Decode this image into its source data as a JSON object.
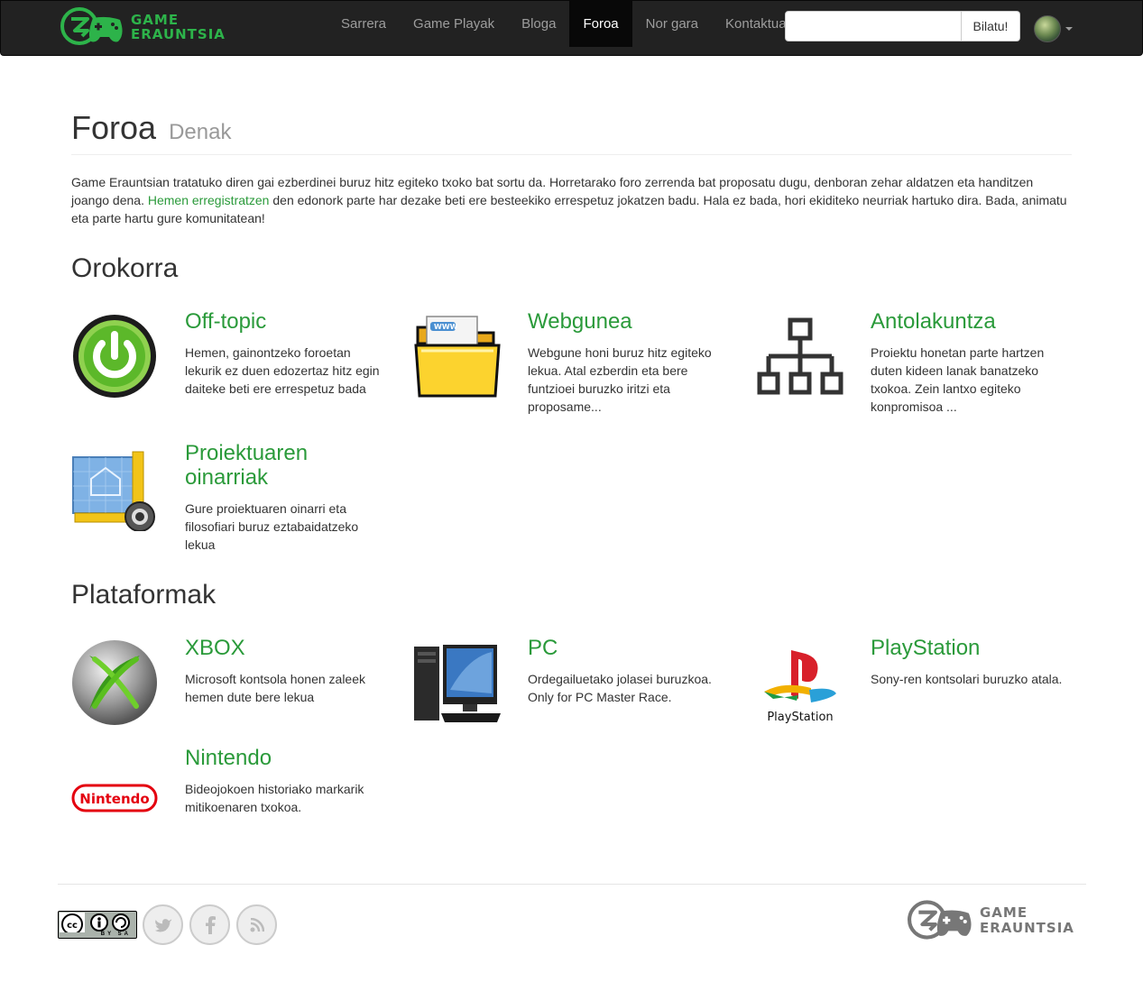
{
  "brand": {
    "line1": "GAME",
    "line2": "ERAUNTSIA"
  },
  "nav": [
    {
      "label": "Sarrera"
    },
    {
      "label": "Game Playak"
    },
    {
      "label": "Bloga"
    },
    {
      "label": "Foroa",
      "active": true
    },
    {
      "label": "Nor gara"
    },
    {
      "label": "Kontaktua"
    }
  ],
  "search": {
    "value": "",
    "placeholder": "",
    "button": "Bilatu!"
  },
  "page": {
    "title": "Foroa",
    "subtitle": "Denak",
    "intro_before": "Game Erauntsian tratatuko diren gai ezberdinei buruz hitz egiteko txoko bat sortu da. Horretarako foro zerrenda bat proposatu dugu, denboran zehar aldatzen eta handitzen joango dena. ",
    "intro_link": "Hemen erregistratzen",
    "intro_after": " den edonork parte har dezake beti ere besteekiko errespetuz jokatzen badu. Hala ez bada, hori ekiditeko neurriak hartuko dira. Bada, animatu eta parte hartu gure komunitatean!"
  },
  "sections": [
    {
      "title": "Orokorra",
      "forums": [
        {
          "title": "Off-topic",
          "desc": "Hemen, gainontzeko foroetan lekurik ez duen edozertaz hitz egin daiteke beti ere errespetuz bada",
          "icon": "power-icon"
        },
        {
          "title": "Webgunea",
          "desc": "Webgune honi buruz hitz egiteko lekua. Atal ezberdin eta bere funtzioei buruzko iritzi eta proposame...",
          "icon": "folder-www-icon"
        },
        {
          "title": "Antolakuntza",
          "desc": "Proiektu honetan parte hartzen duten kideen lanak banatzeko txokoa. Zein lantxo egiteko konpromisoa ...",
          "icon": "org-chart-icon"
        },
        {
          "title": "Proiektuaren oinarriak",
          "desc": "Gure proiektuaren oinarri eta filosofiari buruz eztabaidatzeko lekua",
          "icon": "blueprint-icon"
        }
      ]
    },
    {
      "title": "Plataformak",
      "forums": [
        {
          "title": "XBOX",
          "desc": "Microsoft kontsola honen zaleek hemen dute bere lekua",
          "icon": "xbox-icon"
        },
        {
          "title": "PC",
          "desc": "Ordegailuetako jolasei buruzkoa. Only for PC Master Race.",
          "icon": "pc-icon"
        },
        {
          "title": "PlayStation",
          "desc": "Sony-ren kontsolari buruzko atala.",
          "icon": "playstation-icon",
          "logo_text": "PlayStation"
        },
        {
          "title": "Nintendo",
          "desc": "Bideojokoen historiako markarik mitikoenaren txokoa.",
          "icon": "nintendo-icon",
          "logo_text": "Nintendo"
        }
      ]
    }
  ],
  "footer": {
    "license_text": "BY  SA",
    "social": [
      {
        "icon": "twitter-icon"
      },
      {
        "icon": "facebook-icon"
      },
      {
        "icon": "rss-icon"
      }
    ],
    "brand": {
      "line1": "GAME",
      "line2": "ERAUNTSIA"
    }
  },
  "colors": {
    "accent": "#2a9a3a",
    "navbar": "#222222",
    "brand_green": "#2db34a"
  }
}
